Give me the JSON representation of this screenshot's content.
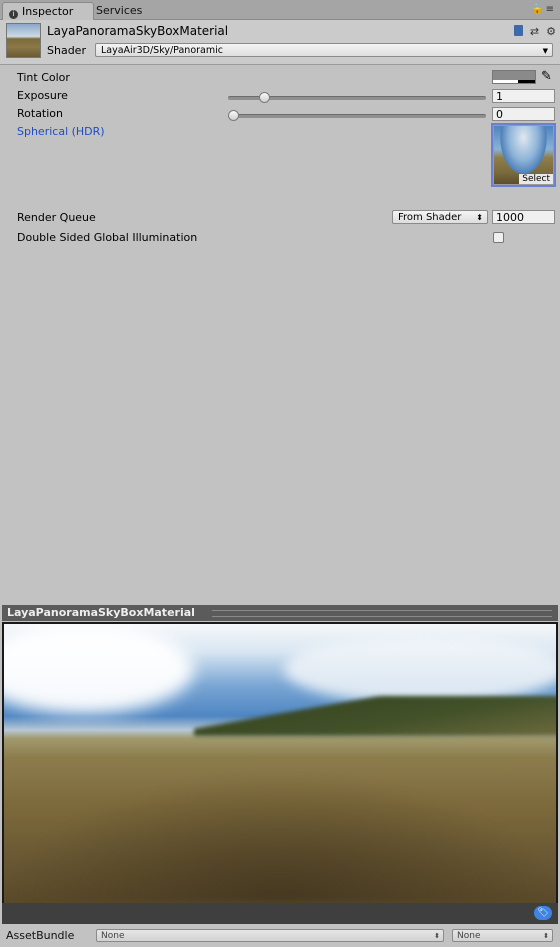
{
  "tabs": [
    {
      "label": "Inspector",
      "active": true
    },
    {
      "label": "Services",
      "active": false
    }
  ],
  "header": {
    "material_name": "LayaPanoramaSkyBoxMaterial",
    "shader_label": "Shader",
    "shader_value": "LayaAir3D/Sky/Panoramic"
  },
  "properties": {
    "tint_color_label": "Tint Color",
    "tint_color_value": "#8a8a8a",
    "exposure_label": "Exposure",
    "exposure_value": "1",
    "exposure_slider_fraction": 0.125,
    "rotation_label": "Rotation",
    "rotation_value": "0",
    "rotation_slider_fraction": 0.0,
    "spherical_label": "Spherical  (HDR)",
    "texture_select_label": "Select",
    "render_queue_label": "Render Queue",
    "render_queue_mode": "From Shader",
    "render_queue_value": "1000",
    "double_sided_gi_label": "Double Sided Global Illumination",
    "double_sided_gi_checked": false
  },
  "preview": {
    "title": "LayaPanoramaSkyBoxMaterial"
  },
  "asset_bundle": {
    "label": "AssetBundle",
    "name_value": "None",
    "variant_value": "None"
  },
  "colors": {
    "panel_bg": "#c2c2c2",
    "link_blue": "#1d4ec2",
    "selection_border": "#6c7fd1"
  }
}
